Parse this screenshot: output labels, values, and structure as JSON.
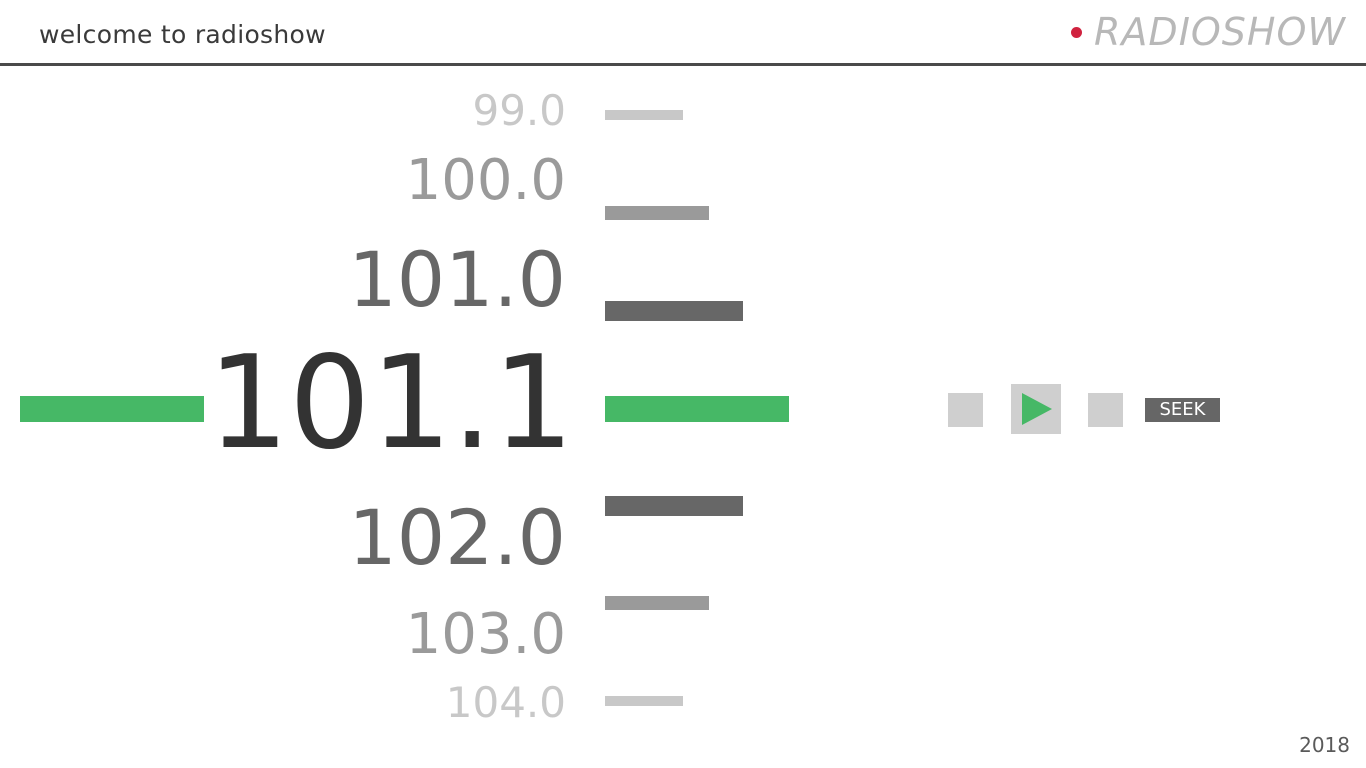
{
  "header": {
    "title": "welcome to radioshow",
    "logo_text": "RADIOSHOW",
    "logo_dot_color": "#d0223f"
  },
  "tuner": {
    "stations": [
      {
        "label": "99.0",
        "color": "#c8c8c8"
      },
      {
        "label": "100.0",
        "color": "#9a9a9a"
      },
      {
        "label": "101.0",
        "color": "#676767"
      },
      {
        "label": "101.1",
        "color": "#333333",
        "active": true
      },
      {
        "label": "102.0",
        "color": "#676767"
      },
      {
        "label": "103.0",
        "color": "#9a9a9a"
      },
      {
        "label": "104.0",
        "color": "#c8c8c8"
      }
    ],
    "active_color": "#46b866"
  },
  "controls": {
    "prev_icon": "prev-square-icon",
    "play_icon": "play-icon",
    "next_icon": "next-square-icon",
    "seek_label": "SEEK"
  },
  "footer": {
    "year": "2018"
  }
}
